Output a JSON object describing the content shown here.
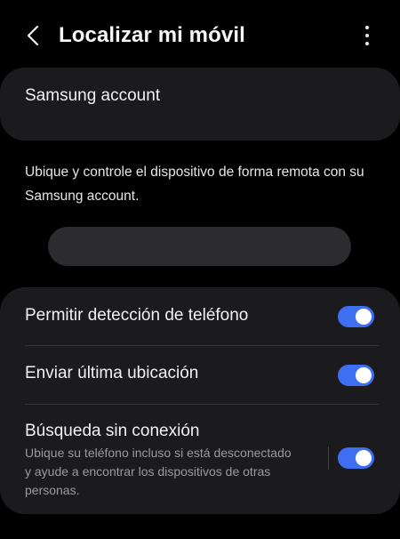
{
  "header": {
    "title": "Localizar mi móvil",
    "back_icon": "chevron-left-icon",
    "more_icon": "more-vertical-icon"
  },
  "account": {
    "label": "Samsung account"
  },
  "description": "Ubique y controle el dispositivo de forma remota con su Samsung account.",
  "settings": {
    "items": [
      {
        "label": "Permitir detección de teléfono",
        "enabled": true
      },
      {
        "label": "Enviar última ubicación",
        "enabled": true
      },
      {
        "label": "Búsqueda sin conexión",
        "sublabel": "Ubique su teléfono incluso si está desconectado y ayude a encontrar los dispositivos de otras personas.",
        "enabled": true
      }
    ]
  },
  "colors": {
    "background": "#000000",
    "card": "#1b1b1d",
    "accent": "#3e6ff2",
    "secondary_text": "#9a9a9c"
  }
}
